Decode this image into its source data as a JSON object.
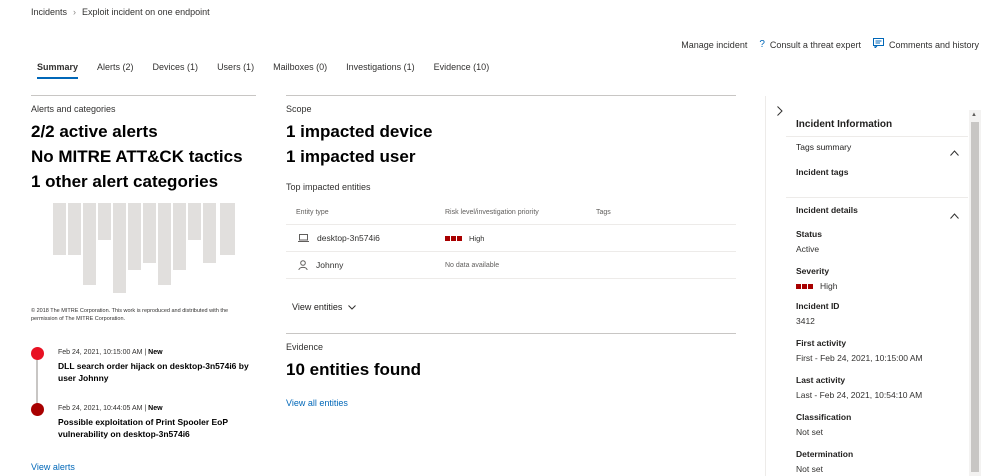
{
  "breadcrumb": {
    "root": "Incidents",
    "current": "Exploit incident on one endpoint"
  },
  "actions": {
    "manage": "Manage incident",
    "consult": "Consult a threat expert",
    "comments": "Comments and history"
  },
  "tabs": [
    {
      "label": "Summary"
    },
    {
      "label": "Alerts (2)"
    },
    {
      "label": "Devices (1)"
    },
    {
      "label": "Users (1)"
    },
    {
      "label": "Mailboxes (0)"
    },
    {
      "label": "Investigations (1)"
    },
    {
      "label": "Evidence (10)"
    }
  ],
  "alerts_section": {
    "heading": "Alerts and categories",
    "line1": "2/2 active alerts",
    "line2": "No MITRE ATT&CK tactics",
    "line3": "1 other alert categories",
    "copyright": "© 2018 The MITRE Corporation. This work is reproduced and distributed with the permission of The MITRE Corporation.",
    "timeline": [
      {
        "date": "Feb 24, 2021, 10:15:00 AM",
        "status": "New",
        "title": "DLL search order hijack on desktop-3n574i6 by user Johnny",
        "color": "#e81123"
      },
      {
        "date": "Feb 24, 2021, 10:44:05 AM",
        "status": "New",
        "title": "Possible exploitation of Print Spooler EoP vulnerability on desktop-3n574i6",
        "color": "#a80000"
      }
    ],
    "view_alerts": "View alerts"
  },
  "scope": {
    "heading": "Scope",
    "line1": "1 impacted device",
    "line2": "1 impacted user",
    "top_entities": "Top impacted entities",
    "columns": [
      "Entity type",
      "Risk level/investigation priority",
      "Tags"
    ],
    "rows": [
      {
        "icon": "laptop-icon",
        "name": "desktop-3n574i6",
        "risk": "High"
      },
      {
        "icon": "user-icon",
        "name": "Johnny",
        "risk": "No data available"
      }
    ],
    "view_entities": "View entities"
  },
  "evidence": {
    "heading": "Evidence",
    "count": "10 entities found",
    "link": "View all entities"
  },
  "panel": {
    "title": "Incident Information",
    "tags_summary": "Tags summary",
    "incident_tags": "Incident tags",
    "details": "Incident details",
    "fields": [
      {
        "label": "Status",
        "value": "Active"
      },
      {
        "label": "Severity",
        "value": "High"
      },
      {
        "label": "Incident ID",
        "value": "3412"
      },
      {
        "label": "First activity",
        "value": "First - Feb 24, 2021, 10:15:00 AM"
      },
      {
        "label": "Last activity",
        "value": "Last - Feb 24, 2021, 10:54:10 AM"
      },
      {
        "label": "Classification",
        "value": "Not set"
      },
      {
        "label": "Determination",
        "value": "Not set"
      }
    ]
  },
  "colors": {
    "accent": "#0067b8",
    "severity_high": "#a80000"
  }
}
